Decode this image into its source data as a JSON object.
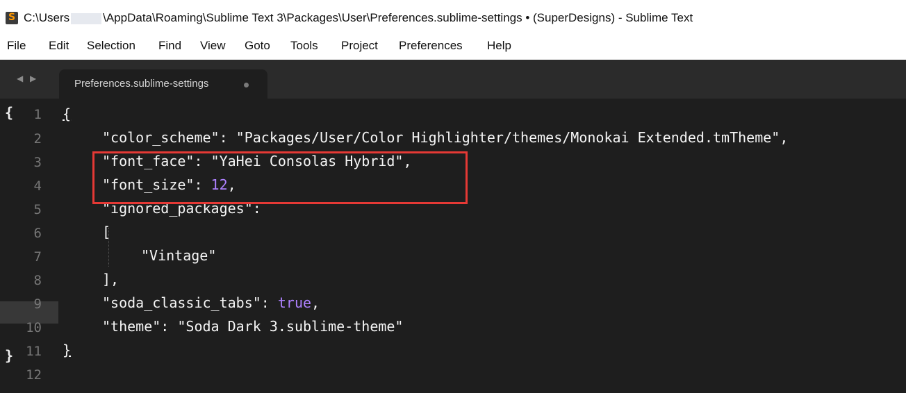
{
  "window": {
    "title_prefix": "C:\\Users",
    "title_suffix": "\\AppData\\Roaming\\Sublime Text 3\\Packages\\User\\Preferences.sublime-settings • (SuperDesigns) - Sublime Text"
  },
  "menu": [
    "File",
    "Edit",
    "Selection",
    "Find",
    "View",
    "Goto",
    "Tools",
    "Project",
    "Preferences",
    "Help"
  ],
  "tab": {
    "nav": "◀ ▶",
    "label": "Preferences.sublime-settings"
  },
  "gutter": {
    "numbers": [
      "1",
      "2",
      "3",
      "4",
      "5",
      "6",
      "7",
      "8",
      "9",
      "10",
      "11",
      "12"
    ],
    "fold_open": "{",
    "fold_close": "}"
  },
  "code": {
    "l1": "{",
    "l2": "\"color_scheme\": \"Packages/User/Color Highlighter/themes/Monokai Extended.tmTheme\",",
    "l3": "\"font_face\": \"YaHei Consolas Hybrid\",",
    "l4_key": "\"font_size\": ",
    "l4_val": "12",
    "l4_end": ",",
    "l5": "\"ignored_packages\":",
    "l6": "[",
    "l7": "\"Vintage\"",
    "l8": "],",
    "l9_key": "\"soda_classic_tabs\": ",
    "l9_val": "true",
    "l9_end": ",",
    "l10": "\"theme\": \"Soda Dark 3.sublime-theme\"",
    "l11": "}"
  },
  "colors": {
    "editor_bg": "#1e1e1e",
    "number": "#ae81ff",
    "highlight_box": "#e53935"
  }
}
